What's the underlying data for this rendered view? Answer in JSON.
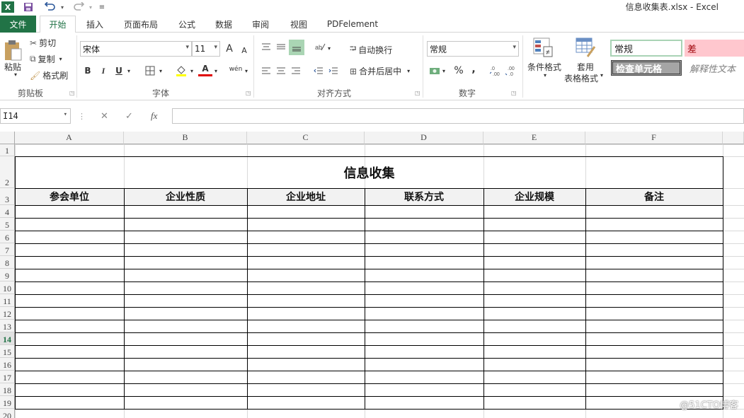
{
  "titlebar": {
    "title": "信息收集表.xlsx - Excel",
    "app_icon": "X"
  },
  "tabs": [
    {
      "label": "文件"
    },
    {
      "label": "开始"
    },
    {
      "label": "插入"
    },
    {
      "label": "页面布局"
    },
    {
      "label": "公式"
    },
    {
      "label": "数据"
    },
    {
      "label": "审阅"
    },
    {
      "label": "视图"
    },
    {
      "label": "PDFelement"
    }
  ],
  "ribbon": {
    "clipboard": {
      "paste": "粘贴",
      "cut": "剪切",
      "copy": "复制",
      "format_painter": "格式刷",
      "label": "剪贴板"
    },
    "font": {
      "name": "宋体",
      "size": "11",
      "bold": "B",
      "italic": "I",
      "underline": "U",
      "font_color": "A",
      "wen": "wén",
      "label": "字体",
      "grow": "A",
      "shrink": "A"
    },
    "align": {
      "wrap": "自动换行",
      "merge": "合并后居中",
      "label": "对齐方式"
    },
    "number": {
      "format": "常规",
      "percent": "%",
      "comma": ",",
      "label": "数字"
    },
    "styles": {
      "conditional": "条件格式",
      "table1": "套用",
      "table2": "表格格式",
      "normal": "常规",
      "bad": "差",
      "check": "检查单元格",
      "explain": "解释性文本"
    }
  },
  "formula_bar": {
    "name_box": "I14",
    "fx": "fx",
    "value": ""
  },
  "sheet": {
    "columns": [
      "A",
      "B",
      "C",
      "D",
      "E",
      "F"
    ],
    "rows": [
      "1",
      "2",
      "3",
      "4",
      "5",
      "6",
      "7",
      "8",
      "9",
      "10",
      "11",
      "12",
      "13",
      "14",
      "15",
      "16",
      "17",
      "18",
      "19",
      "20"
    ],
    "selected_row": "14",
    "title": "信息收集",
    "headers": [
      "参会单位",
      "企业性质",
      "企业地址",
      "联系方式",
      "企业规模",
      "备注"
    ]
  },
  "watermark": "@51CTO博客",
  "colors": {
    "excel_green": "#217346",
    "bad_fill": "#ffc7ce",
    "check_fill": "#a5a5a5"
  }
}
